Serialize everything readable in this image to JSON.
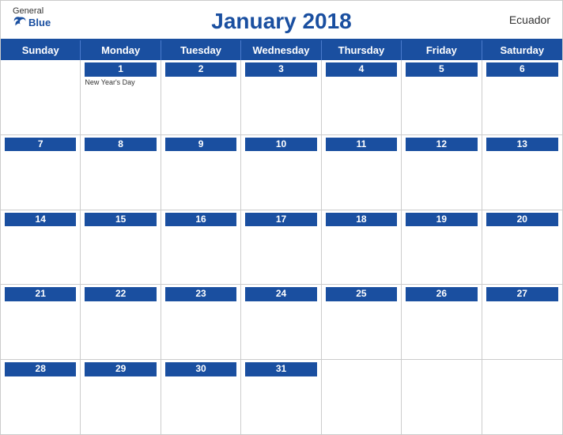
{
  "header": {
    "title": "January 2018",
    "country": "Ecuador",
    "logo": {
      "general": "General",
      "blue": "Blue"
    }
  },
  "days_of_week": [
    "Sunday",
    "Monday",
    "Tuesday",
    "Wednesday",
    "Thursday",
    "Friday",
    "Saturday"
  ],
  "weeks": [
    [
      {
        "day": "",
        "empty": true
      },
      {
        "day": "1",
        "holiday": "New Year's Day"
      },
      {
        "day": "2",
        "holiday": ""
      },
      {
        "day": "3",
        "holiday": ""
      },
      {
        "day": "4",
        "holiday": ""
      },
      {
        "day": "5",
        "holiday": ""
      },
      {
        "day": "6",
        "holiday": ""
      }
    ],
    [
      {
        "day": "7",
        "holiday": ""
      },
      {
        "day": "8",
        "holiday": ""
      },
      {
        "day": "9",
        "holiday": ""
      },
      {
        "day": "10",
        "holiday": ""
      },
      {
        "day": "11",
        "holiday": ""
      },
      {
        "day": "12",
        "holiday": ""
      },
      {
        "day": "13",
        "holiday": ""
      }
    ],
    [
      {
        "day": "14",
        "holiday": ""
      },
      {
        "day": "15",
        "holiday": ""
      },
      {
        "day": "16",
        "holiday": ""
      },
      {
        "day": "17",
        "holiday": ""
      },
      {
        "day": "18",
        "holiday": ""
      },
      {
        "day": "19",
        "holiday": ""
      },
      {
        "day": "20",
        "holiday": ""
      }
    ],
    [
      {
        "day": "21",
        "holiday": ""
      },
      {
        "day": "22",
        "holiday": ""
      },
      {
        "day": "23",
        "holiday": ""
      },
      {
        "day": "24",
        "holiday": ""
      },
      {
        "day": "25",
        "holiday": ""
      },
      {
        "day": "26",
        "holiday": ""
      },
      {
        "day": "27",
        "holiday": ""
      }
    ],
    [
      {
        "day": "28",
        "holiday": ""
      },
      {
        "day": "29",
        "holiday": ""
      },
      {
        "day": "30",
        "holiday": ""
      },
      {
        "day": "31",
        "holiday": ""
      },
      {
        "day": "",
        "empty": true
      },
      {
        "day": "",
        "empty": true
      },
      {
        "day": "",
        "empty": true
      }
    ]
  ],
  "colors": {
    "blue": "#1a4fa0",
    "white": "#ffffff",
    "border": "#cccccc"
  }
}
